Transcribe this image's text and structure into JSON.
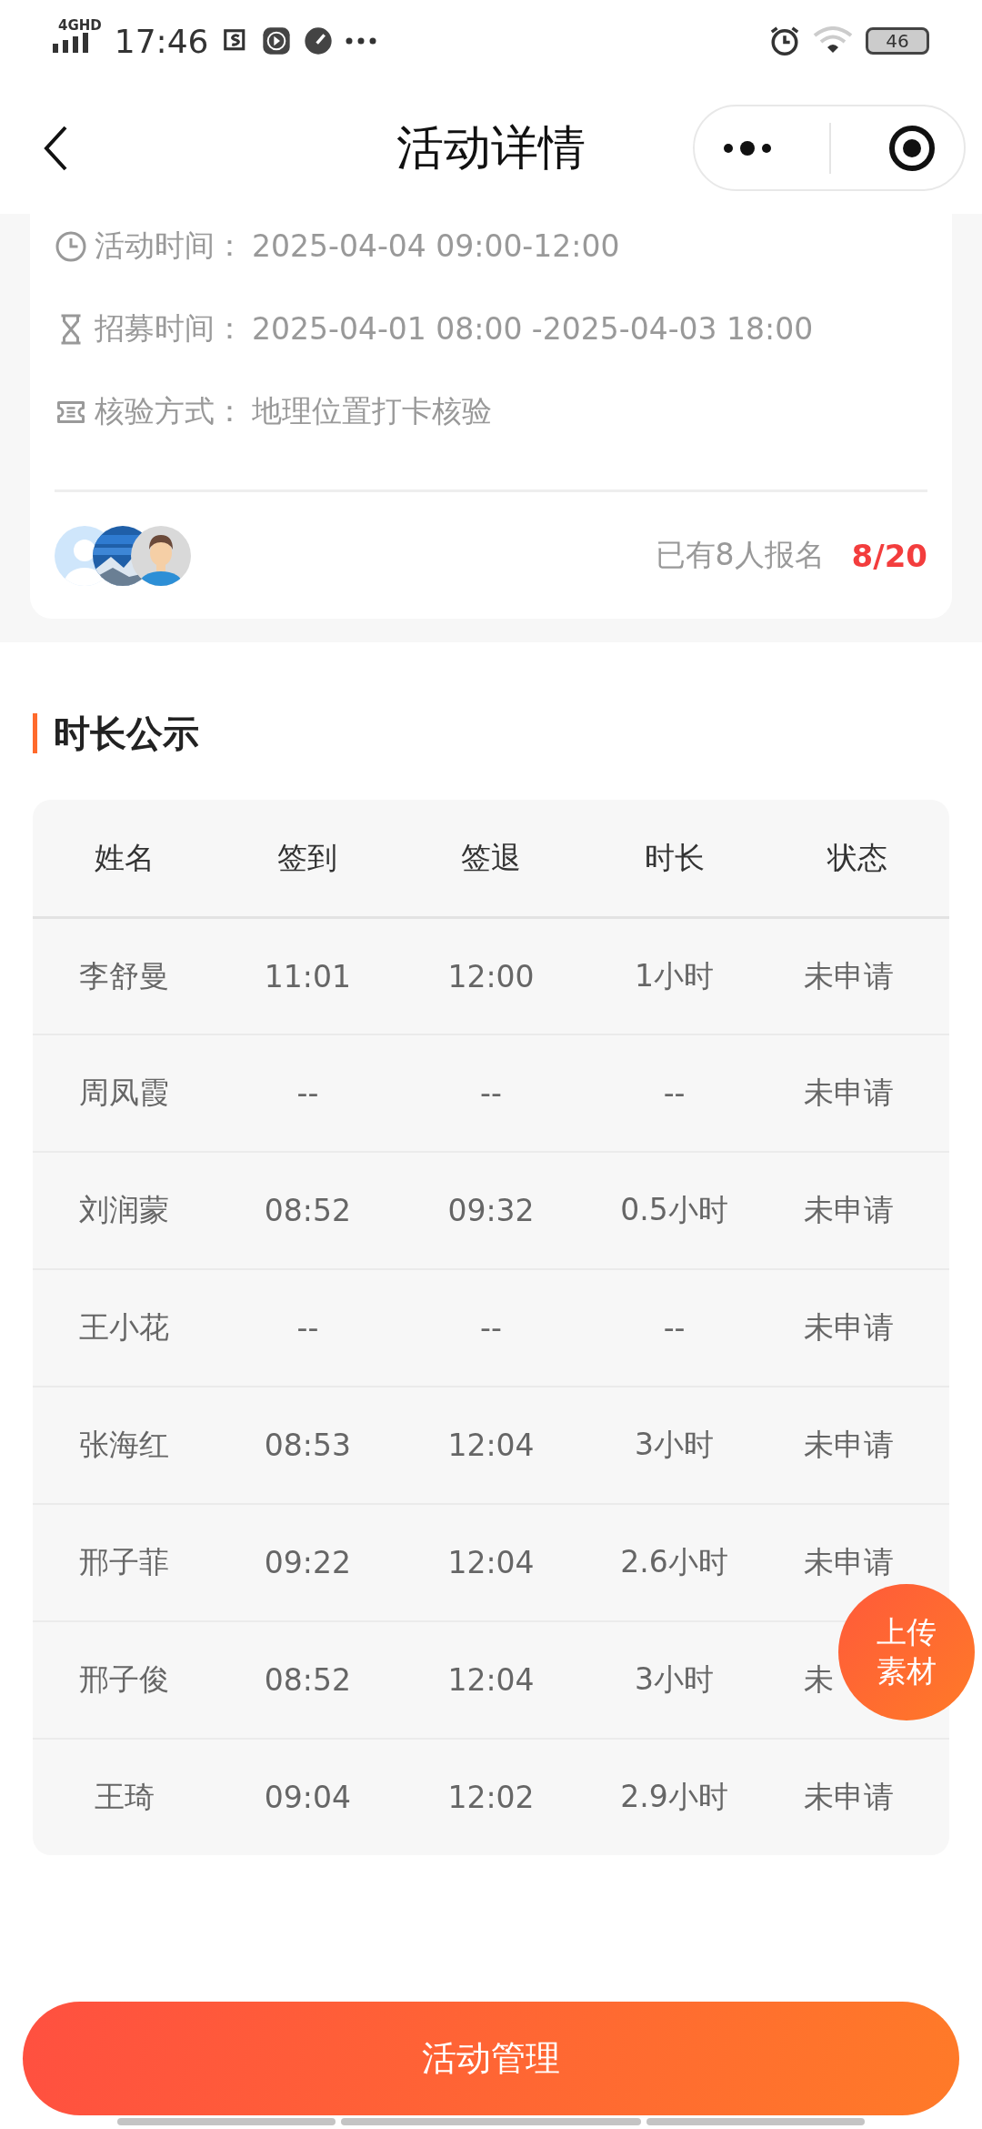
{
  "status_bar": {
    "network": "4GHD",
    "time": "17:46",
    "battery": "46"
  },
  "header": {
    "title": "活动详情"
  },
  "info_rows": [
    {
      "kind": "clock",
      "label": "活动时间：",
      "value": "2025-04-04 09:00-12:00"
    },
    {
      "kind": "hourglass",
      "label": "招募时间：",
      "value": "2025-04-01 08:00 -2025-04-03 18:00"
    },
    {
      "kind": "ticket",
      "label": "核验方式：",
      "value": "地理位置打卡核验"
    }
  ],
  "avatars": [
    {
      "kind": "default"
    },
    {
      "kind": "picture"
    },
    {
      "kind": "person"
    }
  ],
  "signup": {
    "text": "已有8人报名",
    "count": "8/20"
  },
  "section": {
    "title": "时长公示"
  },
  "table": {
    "columns": [
      "姓名",
      "签到",
      "签退",
      "时长",
      "状态"
    ],
    "rows": [
      [
        "李舒曼",
        "11:01",
        "12:00",
        "1小时",
        "未申请"
      ],
      [
        "周凤霞",
        "--",
        "--",
        "--",
        "未申请"
      ],
      [
        "刘润蒙",
        "08:52",
        "09:32",
        "0.5小时",
        "未申请"
      ],
      [
        "王小花",
        "--",
        "--",
        "--",
        "未申请"
      ],
      [
        "张海红",
        "08:53",
        "12:04",
        "3小时",
        "未申请"
      ],
      [
        "邢子菲",
        "09:22",
        "12:04",
        "2.6小时",
        "未申请"
      ],
      [
        "邢子俊",
        "08:52",
        "12:04",
        "3小时",
        "未"
      ],
      [
        "王琦",
        "09:04",
        "12:02",
        "2.9小时",
        "未申请"
      ]
    ]
  },
  "float_button": {
    "lines": [
      "上传",
      "素材"
    ]
  },
  "primary_button": {
    "label": "活动管理"
  }
}
